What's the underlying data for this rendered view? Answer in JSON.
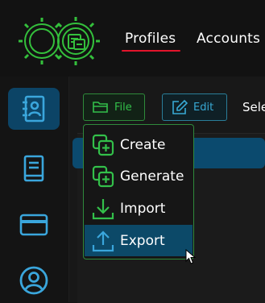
{
  "colors": {
    "accent_green": "#33c04a",
    "accent_blue": "#38a9d4",
    "active_red": "#e3142b",
    "selection": "#0c4968"
  },
  "nav": {
    "tabs": [
      {
        "label": "Profiles",
        "active": true
      },
      {
        "label": "Accounts",
        "active": false
      }
    ]
  },
  "sidebar": {
    "items": [
      {
        "icon": "contacts-book-icon",
        "active": true
      },
      {
        "icon": "book-icon",
        "active": false
      },
      {
        "icon": "credit-card-icon",
        "active": false
      },
      {
        "icon": "user-circle-icon",
        "active": false
      }
    ]
  },
  "toolbar": {
    "file_label": "File",
    "edit_label": "Edit",
    "select_label": "Sele"
  },
  "file_menu": {
    "items": [
      {
        "label": "Create",
        "icon": "copy-plus-icon"
      },
      {
        "label": "Generate",
        "icon": "copy-plus-icon"
      },
      {
        "label": "Import",
        "icon": "download-icon"
      },
      {
        "label": "Export",
        "icon": "upload-icon",
        "hovered": true
      }
    ]
  }
}
